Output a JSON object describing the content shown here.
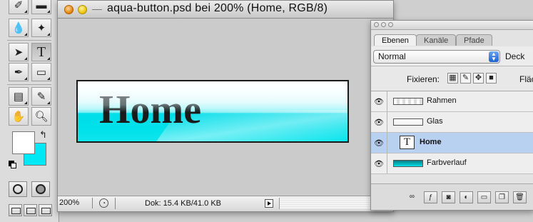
{
  "document": {
    "title": "aqua-button.psd bei 200% (Home, RGB/8)",
    "artwork_text": "Home",
    "zoom": "200%",
    "doc_size": "Dok: 15.4 KB/41.0 KB"
  },
  "tools": {
    "foreground_color": "#ffffff",
    "background_color": "#00e8f4",
    "icons": [
      "lasso-icon",
      "marquee-icon",
      "blur-icon",
      "magic-wand-icon",
      "selection-arrow-icon",
      "type-icon",
      "pen-icon",
      "shape-icon",
      "notes-icon",
      "eyedropper-icon",
      "hand-icon",
      "zoom-icon"
    ]
  },
  "layers_palette": {
    "tabs": [
      "Ebenen",
      "Kanäle",
      "Pfade"
    ],
    "active_tab": "Ebenen",
    "blend_mode": "Normal",
    "opacity_label": "Deck",
    "lock_label": "Fixieren:",
    "fill_label": "Fläc",
    "layers": [
      {
        "name": "Rahmen",
        "type": "raster",
        "visible": true,
        "selected": false
      },
      {
        "name": "Glas",
        "type": "raster",
        "visible": true,
        "selected": false
      },
      {
        "name": "Home",
        "type": "text",
        "visible": true,
        "selected": true
      },
      {
        "name": "Farbverlauf",
        "type": "gradient",
        "visible": true,
        "selected": false
      }
    ],
    "type_thumb_letter": "T"
  },
  "colors": {
    "aqua": "#00e1ea",
    "selection": "#b9d1f0"
  }
}
